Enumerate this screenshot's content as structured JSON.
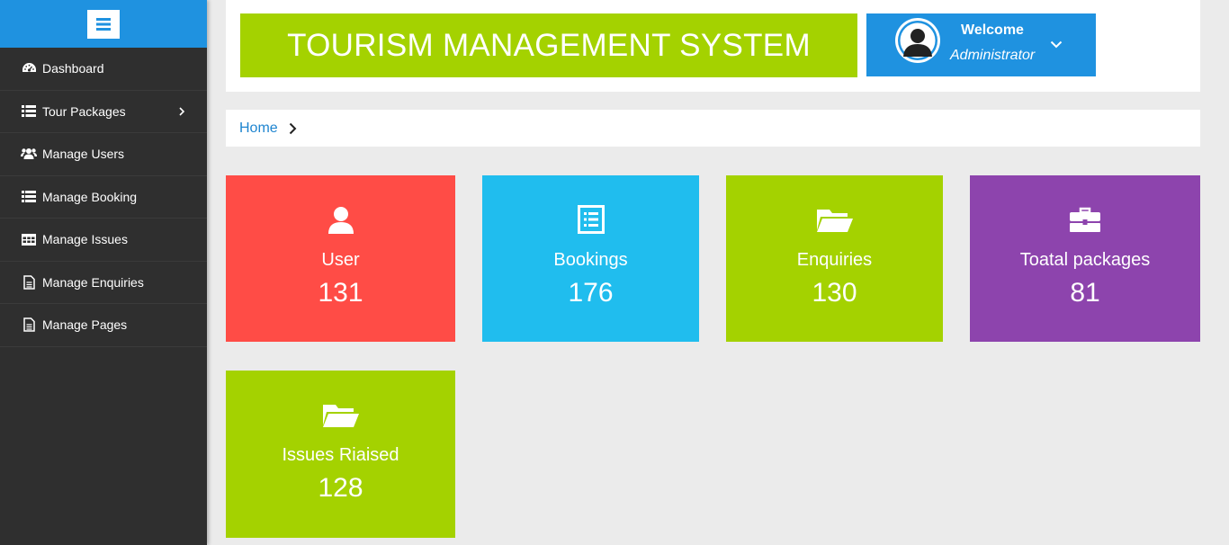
{
  "sidebar": {
    "items": [
      {
        "label": "Dashboard",
        "icon": "dashboard-icon"
      },
      {
        "label": "Tour Packages",
        "icon": "list-icon"
      },
      {
        "label": "Manage Users",
        "icon": "users-icon"
      },
      {
        "label": "Manage Booking",
        "icon": "list-alt-icon"
      },
      {
        "label": "Manage Issues",
        "icon": "table-icon"
      },
      {
        "label": "Manage Enquiries",
        "icon": "file-icon"
      },
      {
        "label": "Manage Pages",
        "icon": "file-icon"
      }
    ]
  },
  "header": {
    "title": "TOURISM MANAGEMENT SYSTEM",
    "welcome": "Welcome",
    "role": "Administrator"
  },
  "breadcrumb": {
    "home": "Home"
  },
  "stats": [
    {
      "label": "User",
      "value": "131",
      "color": "#ff4c46",
      "icon": "user-icon"
    },
    {
      "label": "Bookings",
      "value": "176",
      "color": "#20bdee",
      "icon": "list-alt-icon"
    },
    {
      "label": "Enquiries",
      "value": "130",
      "color": "#a4d200",
      "icon": "folder-open-icon"
    },
    {
      "label": "Toatal packages",
      "value": "81",
      "color": "#8d44ad",
      "icon": "briefcase-icon"
    },
    {
      "label": "Issues Riaised",
      "value": "128",
      "color": "#a4d200",
      "icon": "folder-open-icon"
    }
  ],
  "colors": {
    "sidebar_bg": "#2f2f2f",
    "accent_blue": "#1f92e0",
    "brand_green": "#a4d200"
  }
}
